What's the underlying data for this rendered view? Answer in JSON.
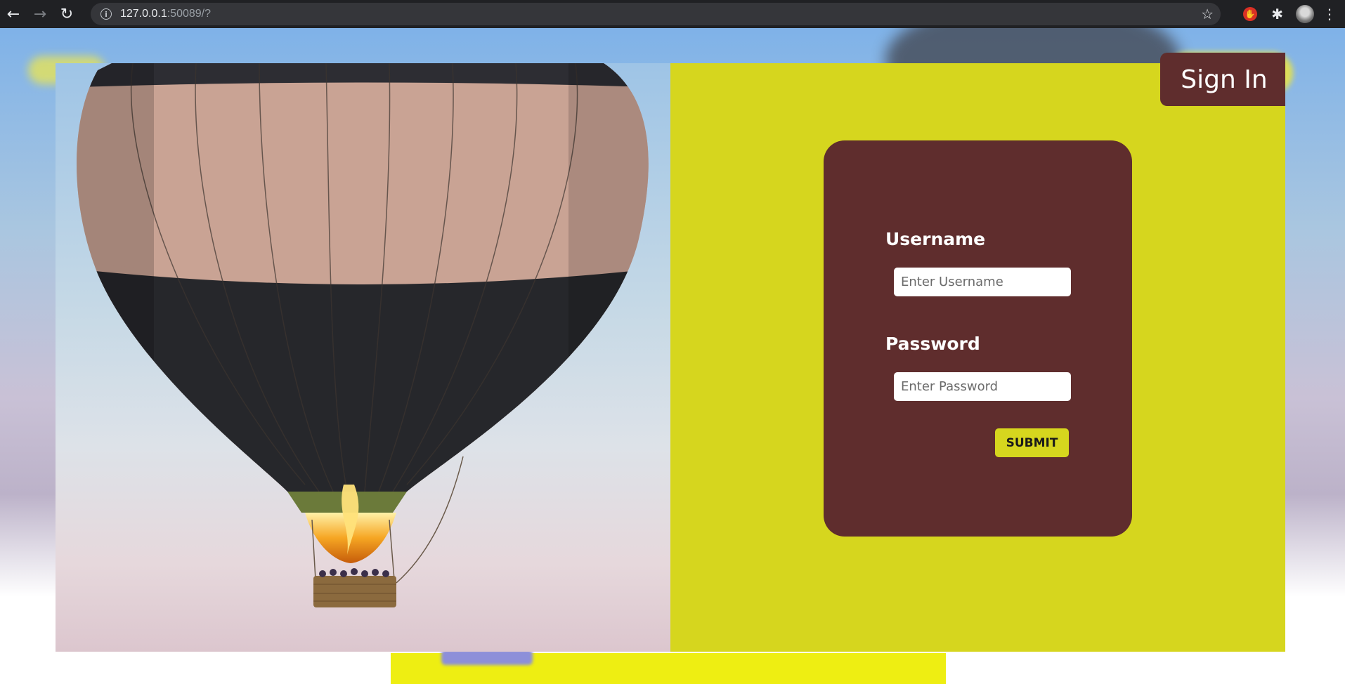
{
  "browser": {
    "url_host": "127.0.0.1",
    "url_rest": ":50089/?",
    "icons": {
      "back": "back-arrow-icon",
      "forward": "forward-arrow-icon",
      "reload": "reload-icon",
      "info": "info-icon",
      "bookmark": "star-icon",
      "extension_stop": "stop-hand-icon",
      "extensions": "puzzle-icon",
      "profile": "avatar",
      "menu": "kebab-menu-icon"
    }
  },
  "header": {
    "sign_in_label": "Sign In"
  },
  "login_form": {
    "username_label": "Username",
    "username_placeholder": "Enter Username",
    "username_value": "",
    "password_label": "Password",
    "password_placeholder": "Enter Password",
    "password_value": "",
    "submit_label": "SUBMIT"
  },
  "colors": {
    "panel_yellow": "#d6d61e",
    "card_maroon": "#5f2d2d",
    "text_white": "#ffffff"
  }
}
